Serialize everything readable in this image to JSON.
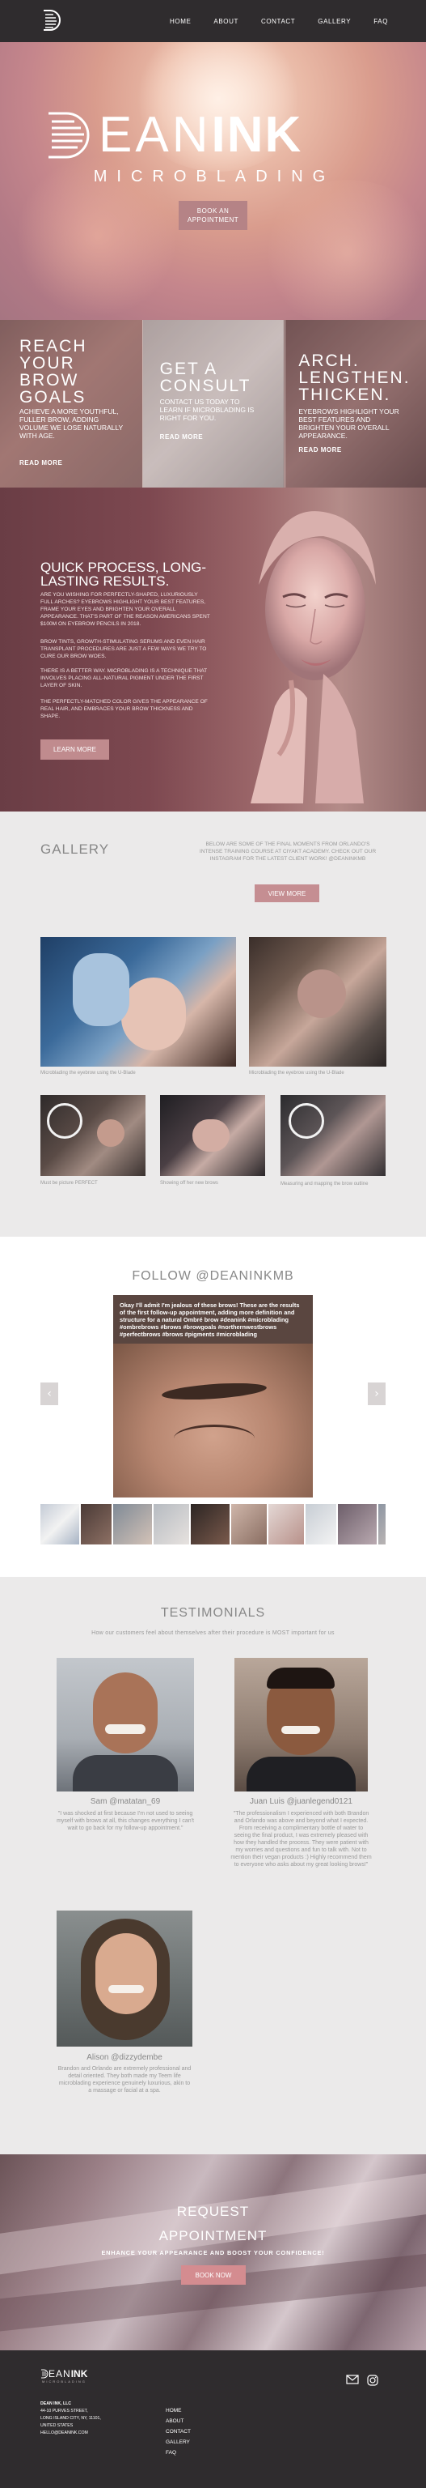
{
  "nav": {
    "links": [
      "HOME",
      "ABOUT",
      "CONTACT",
      "GALLERY",
      "FAQ"
    ]
  },
  "hero": {
    "logo_dean": "EAN",
    "logo_ink": "INK",
    "subtitle": "MICROBLADING",
    "button": "BOOK AN APPOINTMENT"
  },
  "features": [
    {
      "title": "REACH YOUR BROW GOALS",
      "desc": "ACHIEVE A MORE YOUTHFUL, FULLER BROW, ADDING VOLUME WE LOSE NATURALLY WITH AGE.",
      "link": "READ MORE"
    },
    {
      "title": "GET A CONSULT",
      "desc": "CONTACT US TODAY TO LEARN IF MICROBLADING IS RIGHT FOR YOU.",
      "link": "READ MORE"
    },
    {
      "title": "ARCH. LENGTHEN. THICKEN.",
      "desc": "EYEBROWS HIGHLIGHT YOUR BEST FEATURES AND BRIGHTEN YOUR OVERALL APPEARANCE.",
      "link": "READ MORE"
    }
  ],
  "process": {
    "title": "QUICK PROCESS, LONG-LASTING RESULTS.",
    "p1": "ARE YOU WISHING FOR PERFECTLY-SHAPED, LUXURIOUSLY FULL ARCHES? EYEBROWS HIGHLIGHT YOUR BEST FEATURES, FRAME YOUR EYES AND BRIGHTEN YOUR OVERALL APPEARANCE. THAT'S PART OF THE REASON AMERICANS SPENT $100M ON EYEBROW PENCILS IN 2018.",
    "p2": "BROW TINTS, GROWTH-STIMULATING SERUMS AND EVEN HAIR TRANSPLANT PROCEDURES ARE JUST A FEW WAYS WE TRY TO CURE OUR BROW WOES.",
    "p3": "THERE IS A BETTER WAY. MICROBLADING IS A TECHNIQUE THAT INVOLVES PLACING ALL-NATURAL PIGMENT UNDER THE FIRST LAYER OF SKIN.",
    "p4": "THE PERFECTLY-MATCHED COLOR GIVES THE APPEARANCE OF REAL HAIR, AND EMBRACES YOUR BROW THICKNESS AND SHAPE.",
    "button": "LEARN MORE"
  },
  "gallery": {
    "heading": "GALLERY",
    "desc": "BELOW ARE SOME OF THE FINAL MOMENTS FROM ORLANDO'S INTENSE TRAINING COURSE AT CIYAKT ACADEMY. CHECK OUT OUR INSTAGRAM FOR THE LATEST CLIENT WORK! @DEANINKMB",
    "button": "VIEW MORE",
    "captions": [
      "Microblading the eyebrow using the U-Blade",
      "Microblading the eyebrow using the U-Blade",
      "Must be picture PERFECT",
      "Showing off her new brows",
      "Measuring and mapping the brow outline"
    ]
  },
  "follow": {
    "heading": "FOLLOW @DEANINKMB",
    "caption": "Okay I'll admit I'm jealous of these brows! These are the results of the first follow-up appointment, adding more definition and structure for a natural Ombré brow #deanink #microblading #ombrebrows #brows #browgoals #northernwestbrows #perfectbrows #brows #pigments #microblading",
    "prev": "‹",
    "next": "›"
  },
  "testimonials": {
    "heading": "TESTIMONIALS",
    "sub": "How our customers feel about themselves after their procedure is MOST important for us",
    "items": [
      {
        "name": "Sam @matatan_69",
        "quote": "\"I was shocked at first because I'm not used to seeing myself with brows at all, this changes everything I can't wait to go back for my follow-up appointment.\""
      },
      {
        "name": "Juan Luis @juanlegend0121",
        "quote": "\"The professionalism I experienced with both Brandon and Orlando was above and beyond what I expected. From receiving a complimentary bottle of water to seeing the final product, I was extremely pleased with how they handled the process. They were patient with my worries and questions and fun to talk with. Not to mention their vegan products :) Highly recommend them to everyone who asks about my great looking brows!\""
      },
      {
        "name": "Alison @dizzydembe",
        "quote": "Brandon and Orlando are extremely professional and detail oriented. They both made my Teem life microblading experience genuinely luxurious, akin to a massage or facial at a spa."
      }
    ]
  },
  "request": {
    "line1": "REQUEST",
    "line2": "APPOINTMENT",
    "sub": "ENHANCE YOUR APPEARANCE AND BOOST YOUR CONFIDENCE!",
    "button": "BOOK NOW"
  },
  "footer": {
    "logo_dean": "EAN",
    "logo_ink": "INK",
    "logo_sub": "MICROBLADING",
    "address": [
      "DEAN INK, LLC",
      "44-10 PURVES STREET,",
      "LONG ISLAND CITY, NY, 11101,",
      "UNITED STATES",
      "HELLO@DEANINK.COM"
    ],
    "links": [
      "HOME",
      "ABOUT",
      "CONTACT",
      "GALLERY",
      "FAQ"
    ]
  },
  "colors": {
    "nav": "#2f2c2e",
    "accent": "#c58e92",
    "background": "#ebeaea"
  }
}
